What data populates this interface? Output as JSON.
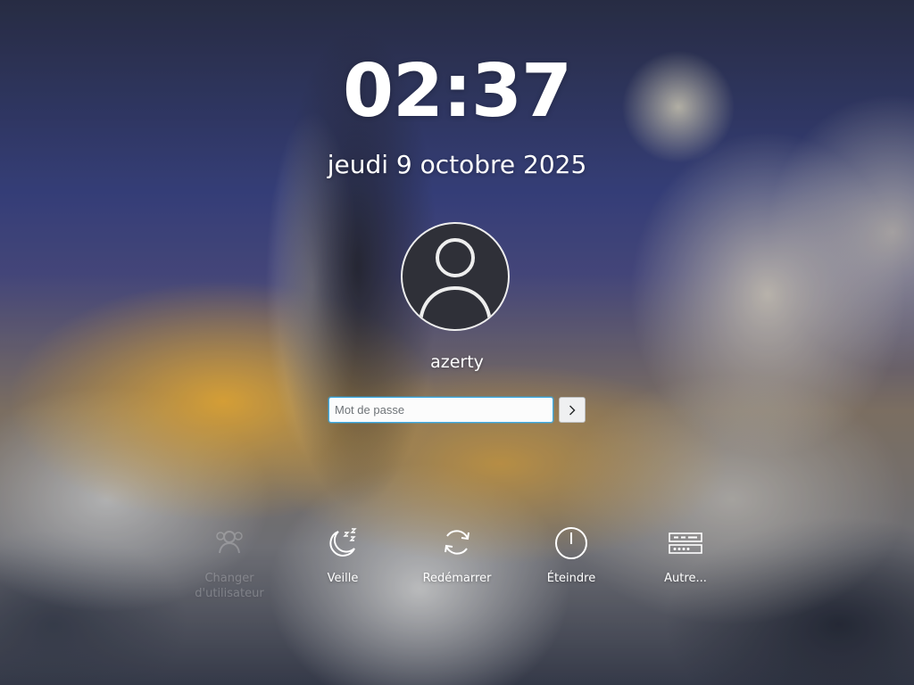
{
  "clock": {
    "time": "02:37"
  },
  "date": {
    "text": "jeudi 9 octobre 2025"
  },
  "user": {
    "name": "azerty",
    "avatar_icon": "user-silhouette-icon"
  },
  "login": {
    "password_placeholder": "Mot de passe",
    "password_value": "",
    "submit_icon": "chevron-right-icon"
  },
  "actions": [
    {
      "id": "switch-user",
      "label": "Changer d'utilisateur",
      "icon": "switch-user-icon",
      "enabled": false
    },
    {
      "id": "sleep",
      "label": "Veille",
      "icon": "moon-zzz-icon",
      "enabled": true
    },
    {
      "id": "restart",
      "label": "Redémarrer",
      "icon": "restart-icon",
      "enabled": true
    },
    {
      "id": "shutdown",
      "label": "Éteindre",
      "icon": "power-icon",
      "enabled": true
    },
    {
      "id": "other",
      "label": "Autre...",
      "icon": "keyboard-icon",
      "enabled": true
    }
  ],
  "colors": {
    "accent": "#3daee9",
    "text": "#ffffff",
    "input_background": "#fcfcfc"
  }
}
